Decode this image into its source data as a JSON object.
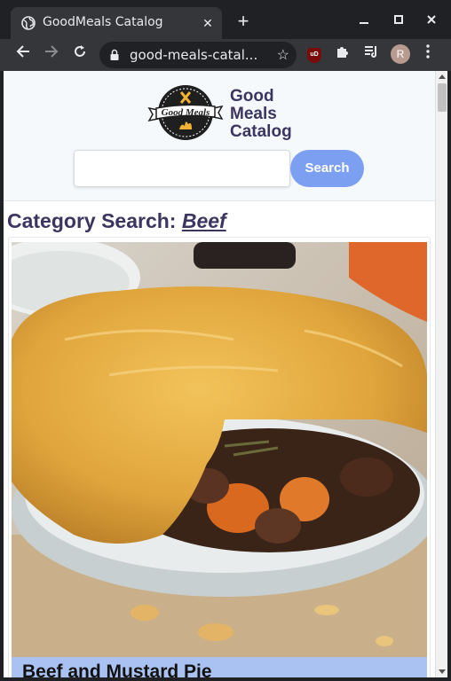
{
  "browser": {
    "tab_title": "GoodMeals Catalog",
    "tab_close": "✕",
    "new_tab": "+",
    "url": "good-meals-catal...",
    "profile_initial": "R",
    "ext_badge": "uD"
  },
  "site": {
    "logo_text": "Good Meals",
    "brand_lines": [
      "Good",
      "Meals",
      "Catalog"
    ],
    "search": {
      "value": "",
      "placeholder": "",
      "button_label": "Search"
    }
  },
  "category": {
    "prefix": "Category Search: ",
    "term": "Beef"
  },
  "results": [
    {
      "title": "Beef and Mustard Pie",
      "image": "beef-pie-photo"
    }
  ],
  "colors": {
    "accent": "#7d9ff2",
    "heading": "#3b3560",
    "caption_bg": "#aac2f2"
  }
}
